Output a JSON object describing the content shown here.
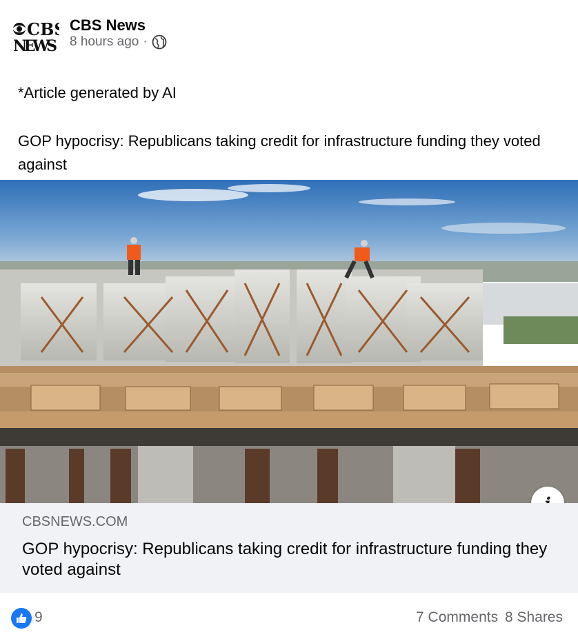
{
  "post": {
    "page_name": "CBS News",
    "logo_line1": "CBS",
    "logo_line2": "NEWS",
    "time": "8 hours ago",
    "separator": "·",
    "privacy_icon": "globe-icon",
    "text_line1": "*Article generated by AI",
    "text_line2": "GOP hypocrisy: Republicans taking credit for infrastructure funding they voted against"
  },
  "image": {
    "description_icon": "photo-construction-bridge",
    "info_label": "i"
  },
  "link_preview": {
    "domain": "CBSNEWS.COM",
    "title": "GOP hypocrisy: Republicans taking credit for infrastructure funding they voted against"
  },
  "engagement": {
    "like_icon": "thumbs-up-icon",
    "like_count": "9",
    "comments": "7 Comments",
    "shares": "8 Shares"
  },
  "colors": {
    "accent": "#1877f2",
    "secondary_text": "#65676b",
    "link_bg": "#f0f2f5"
  }
}
